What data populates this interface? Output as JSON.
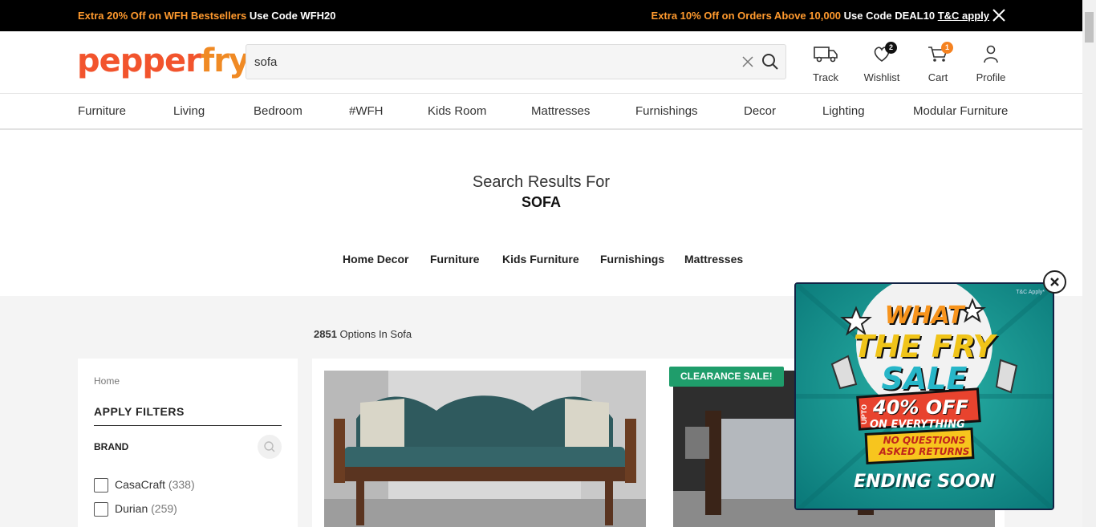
{
  "promo": {
    "left_highlight": "Extra 20% Off on WFH Bestsellers",
    "left_code": " Use Code WFH20",
    "right_highlight": "Extra 10% Off on Orders Above 10,000",
    "right_code": " Use Code DEAL10 ",
    "right_link": "T&C apply"
  },
  "logo": {
    "part1": "pepper",
    "part2": "fry"
  },
  "search": {
    "value": "sofa",
    "placeholder": ""
  },
  "header": {
    "track": "Track",
    "wishlist": "Wishlist",
    "wishlist_count": "2",
    "cart": "Cart",
    "cart_count": "1",
    "profile": "Profile"
  },
  "nav": [
    "Furniture",
    "Living",
    "Bedroom",
    "#WFH",
    "Kids Room",
    "Mattresses",
    "Furnishings",
    "Decor",
    "Lighting",
    "Modular Furniture"
  ],
  "results": {
    "heading": "Search Results For",
    "query": "SOFA",
    "categories": [
      "Home Decor",
      "Furniture",
      "Kids Furniture",
      "Furnishings",
      "Mattresses"
    ]
  },
  "count": {
    "number": "2851",
    "text": " Options In Sofa"
  },
  "filters": {
    "breadcrumb": "Home",
    "title": "APPLY FILTERS",
    "brand_label": "BRAND",
    "options": [
      {
        "name": "CasaCraft",
        "count": "(338)"
      },
      {
        "name": "Durian",
        "count": "(259)"
      }
    ]
  },
  "products": {
    "badge": "CLEARANCE SALE!"
  },
  "popup": {
    "tnc": "T&C Apply*",
    "line1": "WHAT",
    "line2": "THE FRY",
    "line3": "SALE",
    "upto": "UPTO",
    "offer": "40% OFF",
    "offer_sub": "ON EVERYTHING",
    "returns1": "NO QUESTIONS",
    "returns2": "ASKED RETURNS",
    "ending": "ENDING SOON"
  },
  "colors": {
    "brand": "#f2542d",
    "promo_orange": "#ff9a2e",
    "clearance": "#1f9d6b",
    "popup_bg": "#0f8f8a"
  }
}
